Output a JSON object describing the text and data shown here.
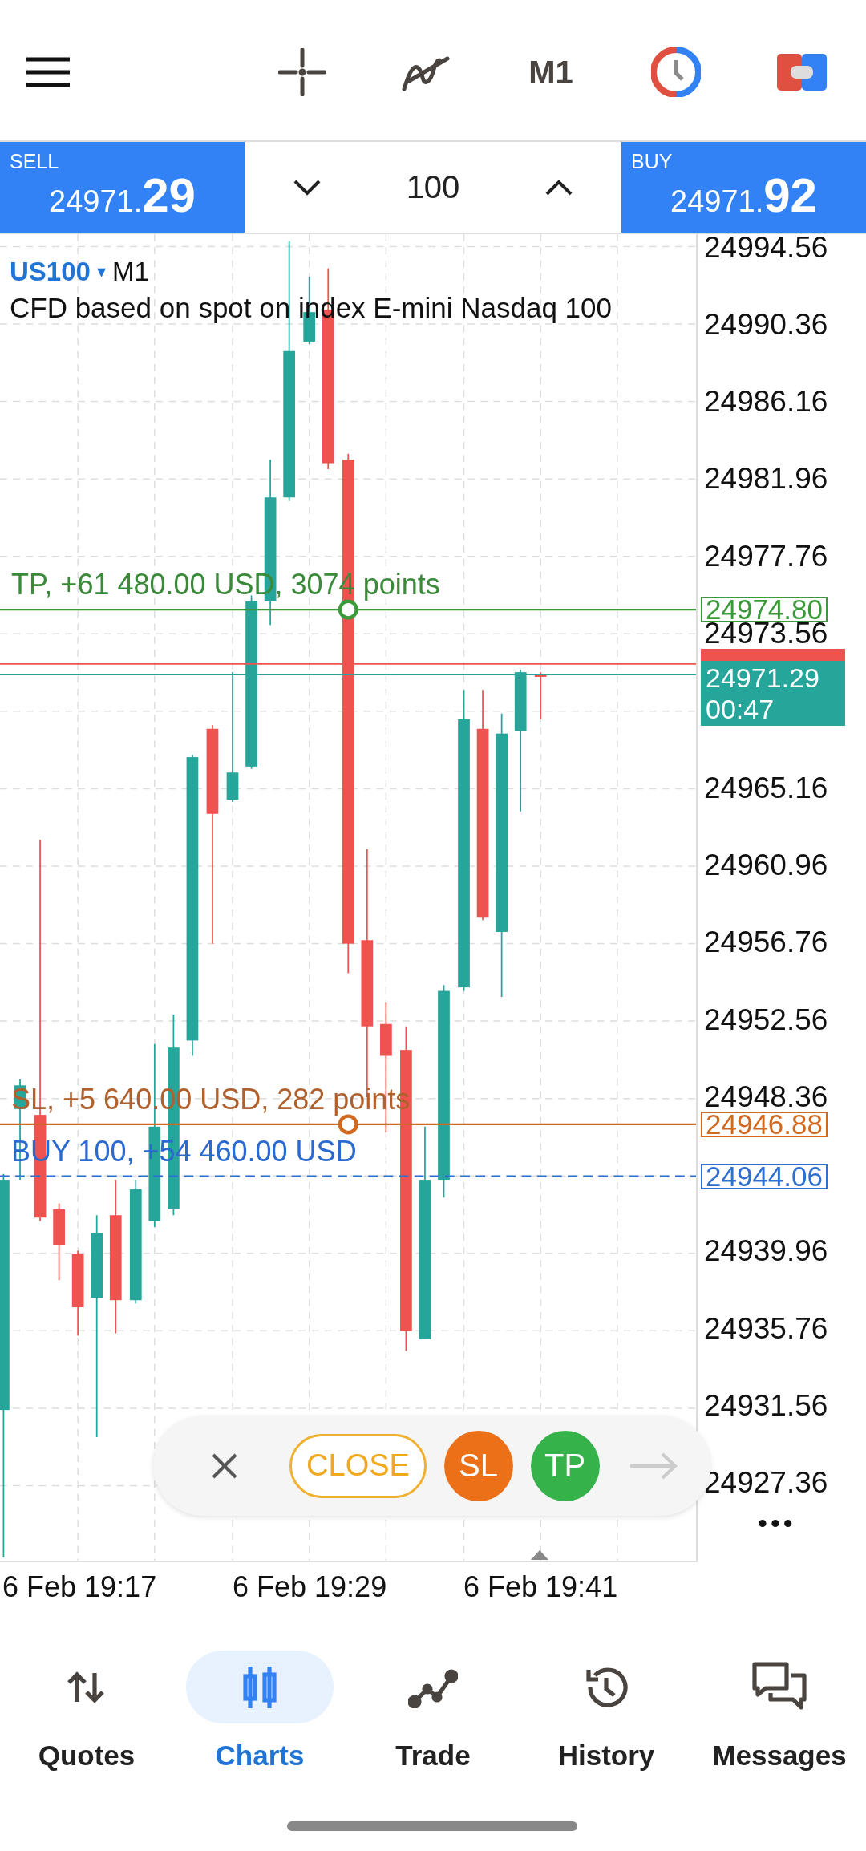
{
  "toolbar": {
    "timeframe": "M1"
  },
  "trade_bar": {
    "sell": {
      "label": "SELL",
      "price_main": "24971.",
      "price_big": "29"
    },
    "volume": "100",
    "buy": {
      "label": "BUY",
      "price_main": "24971.",
      "price_big": "92"
    }
  },
  "chart": {
    "symbol": "US100",
    "symbol_caret": "▾",
    "timeframe": "M1",
    "description": "CFD based on spot on index E-mini Nasdaq 100",
    "price_labels": [
      "24994.56",
      "24990.36",
      "24986.16",
      "24981.96",
      "24977.76",
      "24973.56",
      "24965.16",
      "24960.96",
      "24956.76",
      "24952.56",
      "24948.36",
      "24939.96",
      "24935.76",
      "24931.56",
      "24927.36"
    ],
    "time_labels": [
      "6 Feb 19:17",
      "6 Feb 19:29",
      "6 Feb 19:41"
    ],
    "lines": [
      {
        "kind": "tp",
        "text": "TP, +61 480.00 USD, 3074 points",
        "price": "24974.80"
      },
      {
        "kind": "sl",
        "text": "SL, +5 640.00 USD, 282 points",
        "price": "24946.88"
      },
      {
        "kind": "position",
        "text": "BUY 100,  +54 460.00 USD",
        "price": "24944.06"
      }
    ],
    "current_price": {
      "price": "24971.29",
      "timer": "00:47"
    },
    "more": "•••"
  },
  "position_controls": {
    "close": "CLOSE",
    "sl": "SL",
    "tp": "TP"
  },
  "bottom_nav": [
    {
      "label": "Quotes",
      "selected": false
    },
    {
      "label": "Charts",
      "selected": true
    },
    {
      "label": "Trade",
      "selected": false
    },
    {
      "label": "History",
      "selected": false
    },
    {
      "label": "Messages",
      "selected": false
    }
  ]
}
